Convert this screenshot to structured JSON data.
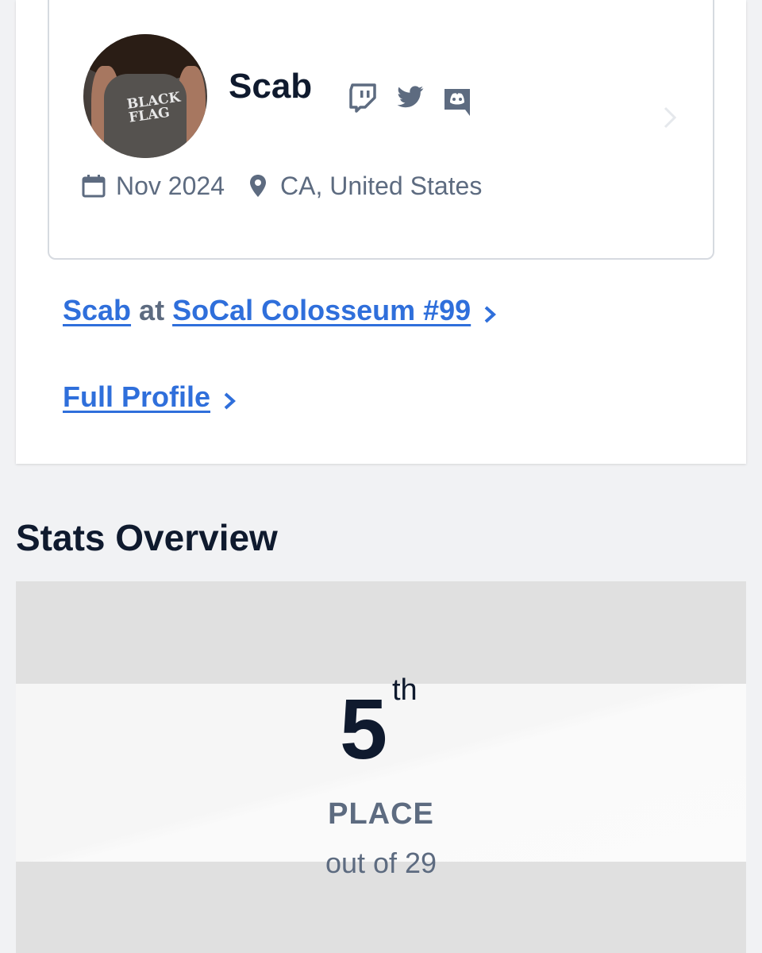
{
  "profile": {
    "name": "Scab",
    "joined": "Nov 2024",
    "location": "CA, United States",
    "avatar_shirt_text": "BLACK FLAG",
    "socials": [
      "twitch-icon",
      "twitter-icon",
      "discord-icon"
    ]
  },
  "links": {
    "event_player": "Scab",
    "event_connector": "at",
    "event_name": "SoCal Colosseum #99",
    "full_profile": "Full Profile"
  },
  "stats": {
    "section_title": "Stats Overview",
    "placement": "5",
    "placement_suffix": "th",
    "placement_label": "PLACE",
    "placement_total": "out of 29"
  },
  "colors": {
    "link": "#2f6fdb",
    "muted": "#5d6b80",
    "heading": "#0f1a2e"
  }
}
